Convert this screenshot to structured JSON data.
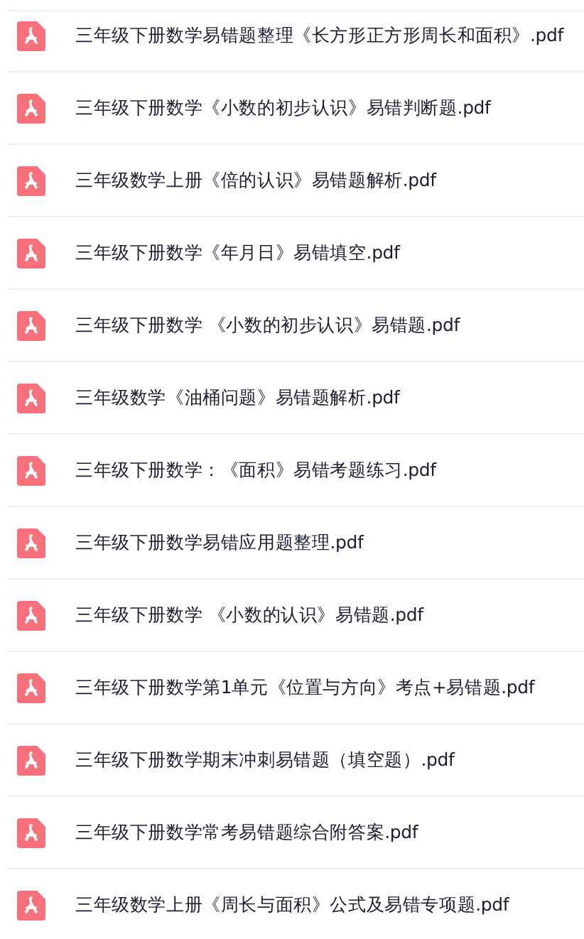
{
  "files": [
    {
      "name": "三年级下册数学易错题整理《长方形正方形周长和面积》.pdf"
    },
    {
      "name": "三年级下册数学《小数的初步认识》易错判断题.pdf"
    },
    {
      "name": "三年级数学上册《倍的认识》易错题解析.pdf"
    },
    {
      "name": "三年级下册数学《年月日》易错填空.pdf"
    },
    {
      "name": "三年级下册数学 《小数的初步认识》易错题.pdf"
    },
    {
      "name": "三年级数学《油桶问题》易错题解析.pdf"
    },
    {
      "name": "三年级下册数学：《面积》易错考题练习.pdf"
    },
    {
      "name": "三年级下册数学易错应用题整理.pdf"
    },
    {
      "name": "三年级下册数学 《小数的认识》易错题.pdf"
    },
    {
      "name": "三年级下册数学第1单元《位置与方向》考点+易错题.pdf"
    },
    {
      "name": "三年级下册数学期末冲刺易错题（填空题）.pdf"
    },
    {
      "name": "三年级下册数学常考易错题综合附答案.pdf"
    },
    {
      "name": "三年级数学上册《周长与面积》公式及易错专项题.pdf"
    }
  ]
}
